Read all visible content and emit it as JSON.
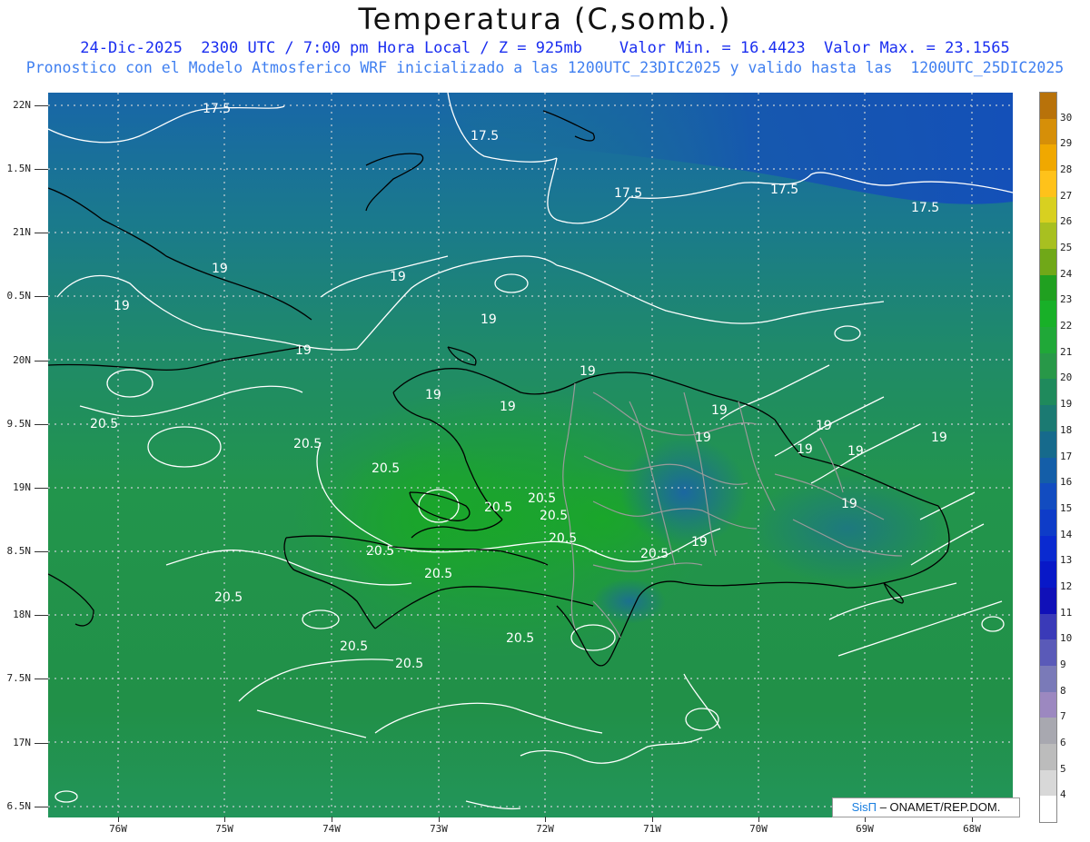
{
  "header": {
    "title": "Temperatura (C,somb.)",
    "subtitle_line1": "24-Dic-2025  2300 UTC / 7:00 pm Hora Local / Z = 925mb    Valor Min. = 16.4423  Valor Max. = 23.1565",
    "subtitle_line2": "Pronostico con el Modelo Atmosferico WRF inicializado a las 1200UTC_23DIC2025 y valido hasta las  1200UTC_25DIC2025"
  },
  "axes": {
    "lat_labels": [
      "22N",
      "1.5N",
      "21N",
      "0.5N",
      "20N",
      "9.5N",
      "19N",
      "8.5N",
      "18N",
      "7.5N",
      "17N",
      "6.5N"
    ],
    "lon_labels": [
      "76W",
      "75W",
      "74W",
      "73W",
      "72W",
      "71W",
      "70W",
      "69W",
      "68W"
    ]
  },
  "colorbar": {
    "labels": [
      "30",
      "29",
      "28",
      "27",
      "26",
      "25",
      "24",
      "23",
      "22",
      "21",
      "20",
      "19",
      "18",
      "17",
      "16",
      "15",
      "14",
      "13",
      "12",
      "11",
      "10",
      "9",
      "8",
      "7",
      "6",
      "5",
      "4"
    ],
    "colors": [
      "#b8720a",
      "#d68f08",
      "#f0a800",
      "#ffc21a",
      "#d8d020",
      "#a8c020",
      "#70a818",
      "#20a020",
      "#18b028",
      "#20a838",
      "#289848",
      "#1f8a5c",
      "#1b7a72",
      "#166a8c",
      "#145ea8",
      "#124cc0",
      "#0e3cc8",
      "#0a2ad0",
      "#0818c8",
      "#1010b8",
      "#3a3ab8",
      "#5a5ab8",
      "#7a7ab8",
      "#9c88c0",
      "#a8a8b0",
      "#bcbcbc",
      "#d8d8d8",
      "#ffffff"
    ]
  },
  "contour_labels": [
    "17.5",
    "17.5",
    "17.5",
    "17.5",
    "17.5",
    "19",
    "19",
    "19",
    "19",
    "19",
    "19",
    "19",
    "19",
    "19",
    "19",
    "19",
    "19",
    "19",
    "19",
    "19",
    "19",
    "20.5",
    "20.5",
    "20.5",
    "20.5",
    "20.5",
    "20.5",
    "20.5",
    "20.5",
    "20.5",
    "20.5",
    "20.5",
    "20.5",
    "20.5",
    "20.5"
  ],
  "credit": {
    "logo": "SisΠ",
    "text": " – ONAMET/REP.DOM."
  }
}
